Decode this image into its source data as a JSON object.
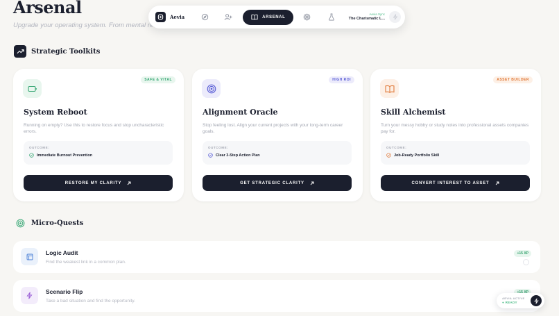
{
  "page": {
    "title": "Arsenal",
    "subtitle": "Upgrade your operating system. From mental recov"
  },
  "nav": {
    "brand": "Aevia",
    "active_label": "ARSENAL",
    "icons": [
      "compass-icon",
      "user-plus-icon",
      "book-icon",
      "target-icon",
      "flask-icon"
    ],
    "now_playing": {
      "label": "Aevia Sync",
      "title": "The Charismatic L..."
    }
  },
  "toolkits": {
    "heading": "Strategic Toolkits",
    "cards": [
      {
        "title": "System Reboot",
        "badge": "SAFE & VITAL",
        "desc": "Running on empty? Use this to restore focus and stop uncharacteristic errors.",
        "outcome_label": "OUTCOME:",
        "outcome": "Immediate Burnout Prevention",
        "cta": "RESTORE MY CLARITY",
        "icon": "battery-icon",
        "accent": "#3aa876",
        "accent_bg": "#e8f6ee"
      },
      {
        "title": "Alignment Oracle",
        "badge": "HIGH ROI",
        "desc": "Stop feeling lost. Align your current projects with your long-term career goals.",
        "outcome_label": "OUTCOME:",
        "outcome": "Clear 3-Step Action Plan",
        "cta": "GET STRATEGIC CLARITY",
        "icon": "target-icon",
        "accent": "#5b5fd6",
        "accent_bg": "#ecebfb"
      },
      {
        "title": "Skill Alchemist",
        "badge": "ASSET BUILDER",
        "desc": "Turn your messy hobby or study notes into professional assets companies pay for.",
        "outcome_label": "OUTCOME:",
        "outcome": "Job-Ready Portfolio Skill",
        "cta": "CONVERT INTEREST TO ASSET",
        "icon": "book-icon",
        "accent": "#e07a3a",
        "accent_bg": "#fdf0e6"
      }
    ]
  },
  "quests": {
    "heading": "Micro-Quests",
    "items": [
      {
        "title": "Logic Audit",
        "desc": "Find the weakest link in a common plan.",
        "xp": "+15 XP",
        "icon": "layout-icon",
        "accent": "#4a7fd6",
        "accent_bg": "#eaf1fb"
      },
      {
        "title": "Scenario Flip",
        "desc": "Take a bad situation and find the opportunity.",
        "xp": "+15 XP",
        "icon": "zap-icon",
        "accent": "#9b5fd6",
        "accent_bg": "#f3ecfb"
      }
    ]
  },
  "status": {
    "line1": "AEVIA ACTIVE",
    "line2": "READY"
  }
}
